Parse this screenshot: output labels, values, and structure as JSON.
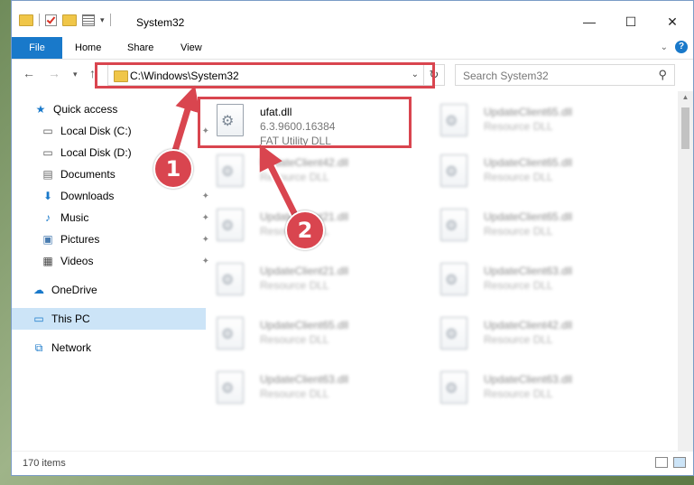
{
  "window": {
    "title": "System32",
    "controls": {
      "minimize": "—",
      "maximize": "☐",
      "close": "✕"
    }
  },
  "ribbon": {
    "tabs": [
      "File",
      "Home",
      "Share",
      "View"
    ],
    "help": "?"
  },
  "address": {
    "path": "C:\\Windows\\System32",
    "search_placeholder": "Search System32"
  },
  "sidebar": {
    "items": [
      {
        "label": "Quick access",
        "icon": "star-icon"
      },
      {
        "label": "Local Disk (C:)",
        "icon": "drive-icon",
        "pinned": true
      },
      {
        "label": "Local Disk (D:)",
        "icon": "drive-icon"
      },
      {
        "label": "Documents",
        "icon": "documents-icon"
      },
      {
        "label": "Downloads",
        "icon": "download-icon",
        "pinned": true
      },
      {
        "label": "Music",
        "icon": "music-icon",
        "pinned": true
      },
      {
        "label": "Pictures",
        "icon": "pictures-icon",
        "pinned": true
      },
      {
        "label": "Videos",
        "icon": "videos-icon",
        "pinned": true
      },
      {
        "label": "OneDrive",
        "icon": "cloud-icon"
      },
      {
        "label": "This PC",
        "icon": "computer-icon",
        "selected": true
      },
      {
        "label": "Network",
        "icon": "network-icon"
      }
    ]
  },
  "files": {
    "highlighted": {
      "name": "ufat.dll",
      "version": "6.3.9600.16384",
      "description": "FAT Utility DLL"
    },
    "left_column": [
      {
        "name": "UpdateClient42.dll",
        "description": "Resource DLL"
      },
      {
        "name": "UpdateClient21.dll",
        "description": "Resource DLL"
      },
      {
        "name": "UpdateClient21.dll",
        "description": "Resource DLL"
      },
      {
        "name": "UpdateClient65.dll",
        "description": "Resource DLL"
      },
      {
        "name": "UpdateClient63.dll",
        "description": "Resource DLL"
      }
    ],
    "right_column": [
      {
        "name": "UpdateClient65.dll",
        "description": "Resource DLL"
      },
      {
        "name": "UpdateClient65.dll",
        "description": "Resource DLL"
      },
      {
        "name": "UpdateClient65.dll",
        "description": "Resource DLL"
      },
      {
        "name": "UpdateClient63.dll",
        "description": "Resource DLL"
      },
      {
        "name": "UpdateClient42.dll",
        "description": "Resource DLL"
      },
      {
        "name": "UpdateClient63.dll",
        "description": "Resource DLL"
      }
    ]
  },
  "status": {
    "count": "170 items"
  },
  "callouts": {
    "one": "1",
    "two": "2"
  },
  "colors": {
    "accent": "#1979ca",
    "highlight": "#d9454f",
    "selected": "#cce4f7"
  }
}
